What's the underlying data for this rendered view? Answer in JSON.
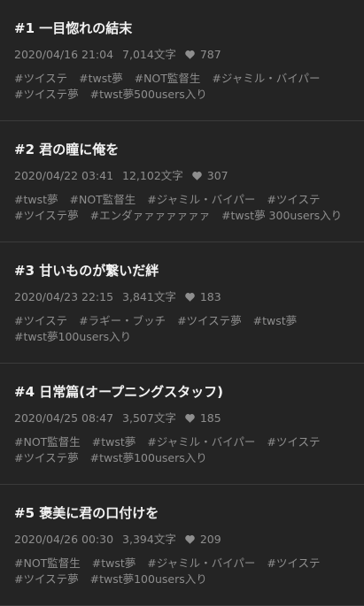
{
  "entries": [
    {
      "title": "#1 一目惚れの結末",
      "date": "2020/04/16 21:04",
      "chars": "7,014文字",
      "likes": "787",
      "tags": [
        "#ツイステ",
        "#twst夢",
        "#NOT監督生",
        "#ジャミル・バイパー",
        "#ツイステ夢",
        "#twst夢500users入り"
      ]
    },
    {
      "title": "#2 君の瞳に俺を",
      "date": "2020/04/22 03:41",
      "chars": "12,102文字",
      "likes": "307",
      "tags": [
        "#twst夢",
        "#NOT監督生",
        "#ジャミル・バイパー",
        "#ツイステ",
        "#ツイステ夢",
        "#エンダァァァァァァァ",
        "#twst夢 300users入り"
      ]
    },
    {
      "title": "#3 甘いものが繋いだ絆",
      "date": "2020/04/23 22:15",
      "chars": "3,841文字",
      "likes": "183",
      "tags": [
        "#ツイステ",
        "#ラギー・ブッチ",
        "#ツイステ夢",
        "#twst夢",
        "#twst夢100users入り"
      ]
    },
    {
      "title": "#4 日常篇(オープニングスタッフ)",
      "date": "2020/04/25 08:47",
      "chars": "3,507文字",
      "likes": "185",
      "tags": [
        "#NOT監督生",
        "#twst夢",
        "#ジャミル・バイパー",
        "#ツイステ",
        "#ツイステ夢",
        "#twst夢100users入り"
      ]
    },
    {
      "title": "#5 褒美に君の口付けを",
      "date": "2020/04/26 00:30",
      "chars": "3,394文字",
      "likes": "209",
      "tags": [
        "#NOT監督生",
        "#twst夢",
        "#ジャミル・バイパー",
        "#ツイステ",
        "#ツイステ夢",
        "#twst夢100users入り"
      ]
    }
  ],
  "icons": {
    "like": "heart-icon"
  },
  "colors": {
    "background": "#242424",
    "title": "#f2f2f2",
    "meta": "#8e8e8e",
    "divider": "#3b3b3b"
  }
}
